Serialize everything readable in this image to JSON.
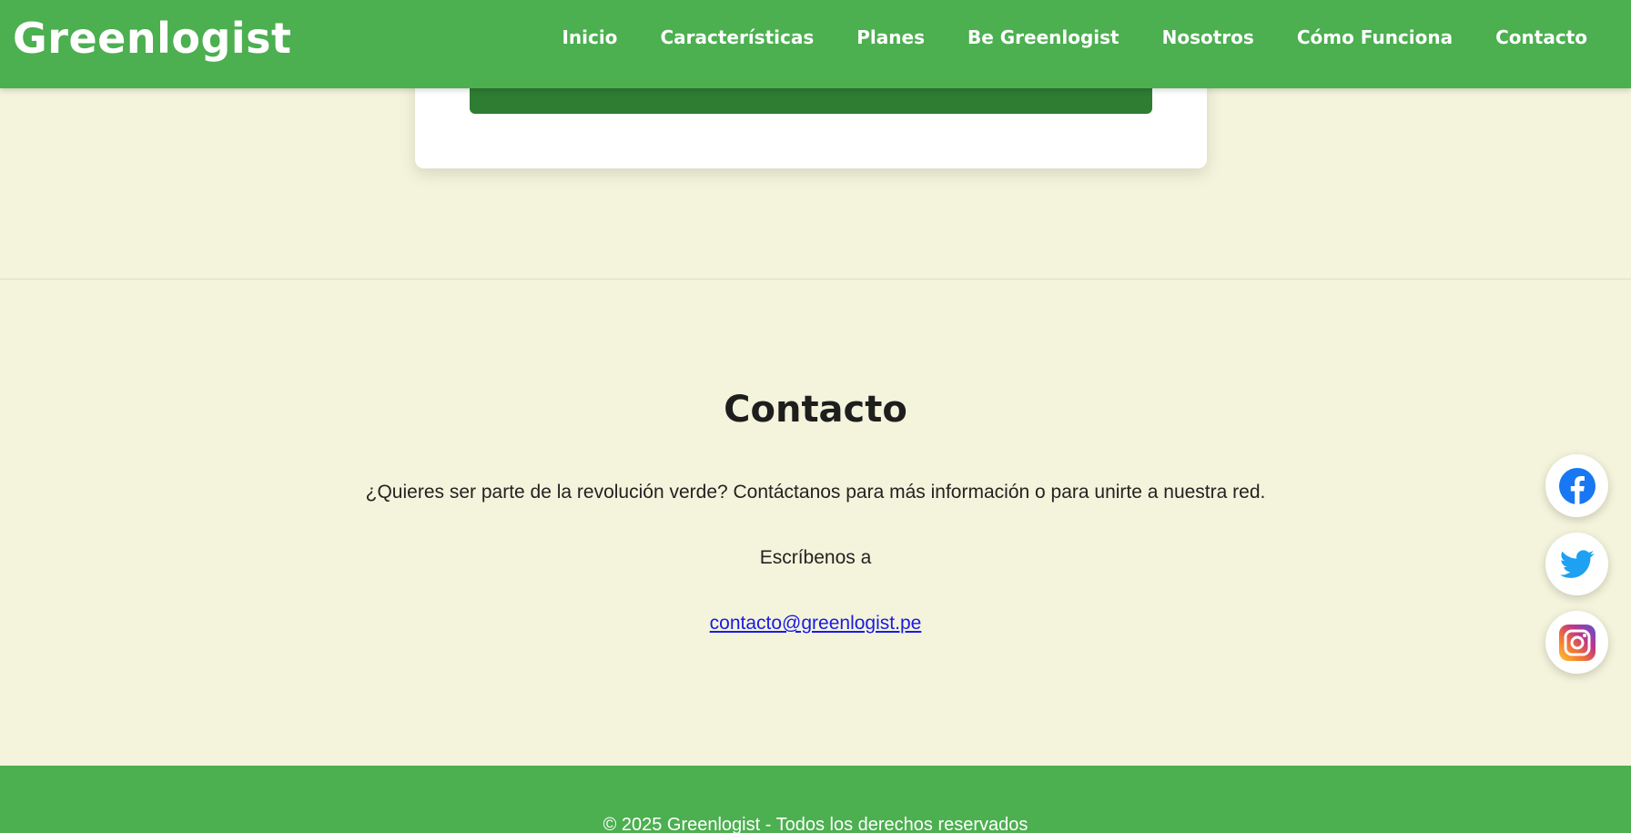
{
  "header": {
    "brand": "Greenlogist",
    "nav": [
      {
        "label": "Inicio"
      },
      {
        "label": "Características"
      },
      {
        "label": "Planes"
      },
      {
        "label": "Be Greenlogist"
      },
      {
        "label": "Nosotros"
      },
      {
        "label": "Cómo Funciona"
      },
      {
        "label": "Contacto"
      }
    ]
  },
  "contact": {
    "title": "Contacto",
    "text": "¿Quieres ser parte de la revolución verde? Contáctanos para más información o para unirte a nuestra red.",
    "write_label": "Escríbenos a",
    "email": "contacto@greenlogist.pe"
  },
  "social": [
    {
      "icon": "facebook-icon",
      "color": "#1877f2"
    },
    {
      "icon": "twitter-icon",
      "color": "#1da1f2"
    },
    {
      "icon": "instagram-icon",
      "color": "#c13584"
    }
  ],
  "footer": {
    "text": "© 2025 Greenlogist - Todos los derechos reservados"
  },
  "colors": {
    "primary": "#4caf50",
    "primary_dark": "#2e7d32",
    "background": "#f4f4dc"
  }
}
